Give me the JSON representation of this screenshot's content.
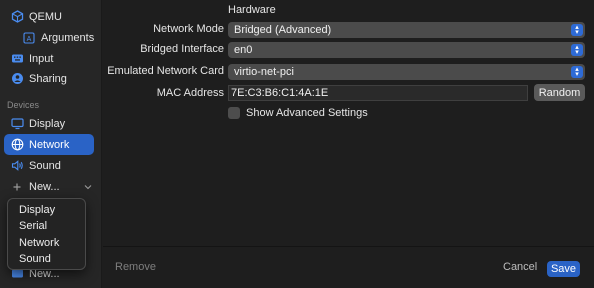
{
  "sidebar": {
    "items": [
      {
        "label": "QEMU",
        "icon": "qemu-icon"
      },
      {
        "label": "Arguments",
        "icon": "arguments-icon"
      },
      {
        "label": "Input",
        "icon": "input-icon"
      },
      {
        "label": "Sharing",
        "icon": "sharing-icon"
      }
    ],
    "devices_header": "Devices",
    "devices": [
      {
        "label": "Display",
        "icon": "display-icon"
      },
      {
        "label": "Network",
        "icon": "globe-icon"
      },
      {
        "label": "Sound",
        "icon": "sound-icon"
      },
      {
        "label": "New...",
        "icon": "plus-icon"
      }
    ],
    "new_bottom_label": "New...",
    "popup_menu": [
      "Display",
      "Serial",
      "Network",
      "Sound"
    ]
  },
  "main": {
    "section_title": "Hardware",
    "network_mode": {
      "label": "Network Mode",
      "value": "Bridged (Advanced)"
    },
    "bridged_interface": {
      "label": "Bridged Interface",
      "value": "en0"
    },
    "emulated_card": {
      "label": "Emulated Network Card",
      "value": "virtio-net-pci"
    },
    "mac": {
      "label": "MAC Address",
      "value": "7E:C3:B6:C1:4A:1E",
      "random_label": "Random"
    },
    "advanced": {
      "label": "Show Advanced Settings",
      "checked": false
    }
  },
  "footer": {
    "remove_label": "Remove",
    "cancel_label": "Cancel",
    "save_label": "Save"
  },
  "colors": {
    "accent": "#2a63c6",
    "background": "#1e1e1e",
    "sidebar": "#262626"
  }
}
